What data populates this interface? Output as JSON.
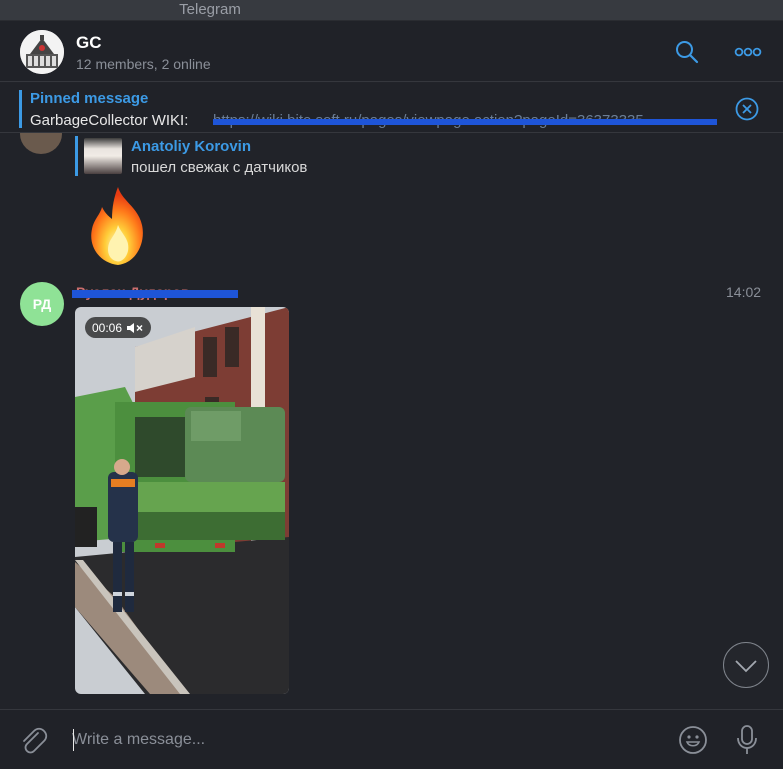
{
  "window": {
    "title": "Telegram"
  },
  "header": {
    "chat_title": "GC",
    "subtitle": "12 members, 2 online",
    "search_icon": "search-icon",
    "more_icon": "more-icon"
  },
  "pinned": {
    "label": "Pinned message",
    "text": "GarbageCollector  WIKI:",
    "link_text": "https://wiki.bite.soft.ru/pages/viewpage.action?pageId=36373335..."
  },
  "messages": {
    "reply": {
      "author": "Anatoliy Korovin",
      "text": "пошел свежак с датчиков"
    },
    "video_message": {
      "avatar_initials": "РД",
      "sender": "Руслан Дударов",
      "time": "14:02",
      "duration": "00:06",
      "mute_icon": "muted-speaker-icon"
    }
  },
  "composer": {
    "placeholder": "Write a message...",
    "value": ""
  },
  "colors": {
    "accent": "#3c9ae5",
    "background": "#212329",
    "avatar_rd": "#8fe296"
  }
}
